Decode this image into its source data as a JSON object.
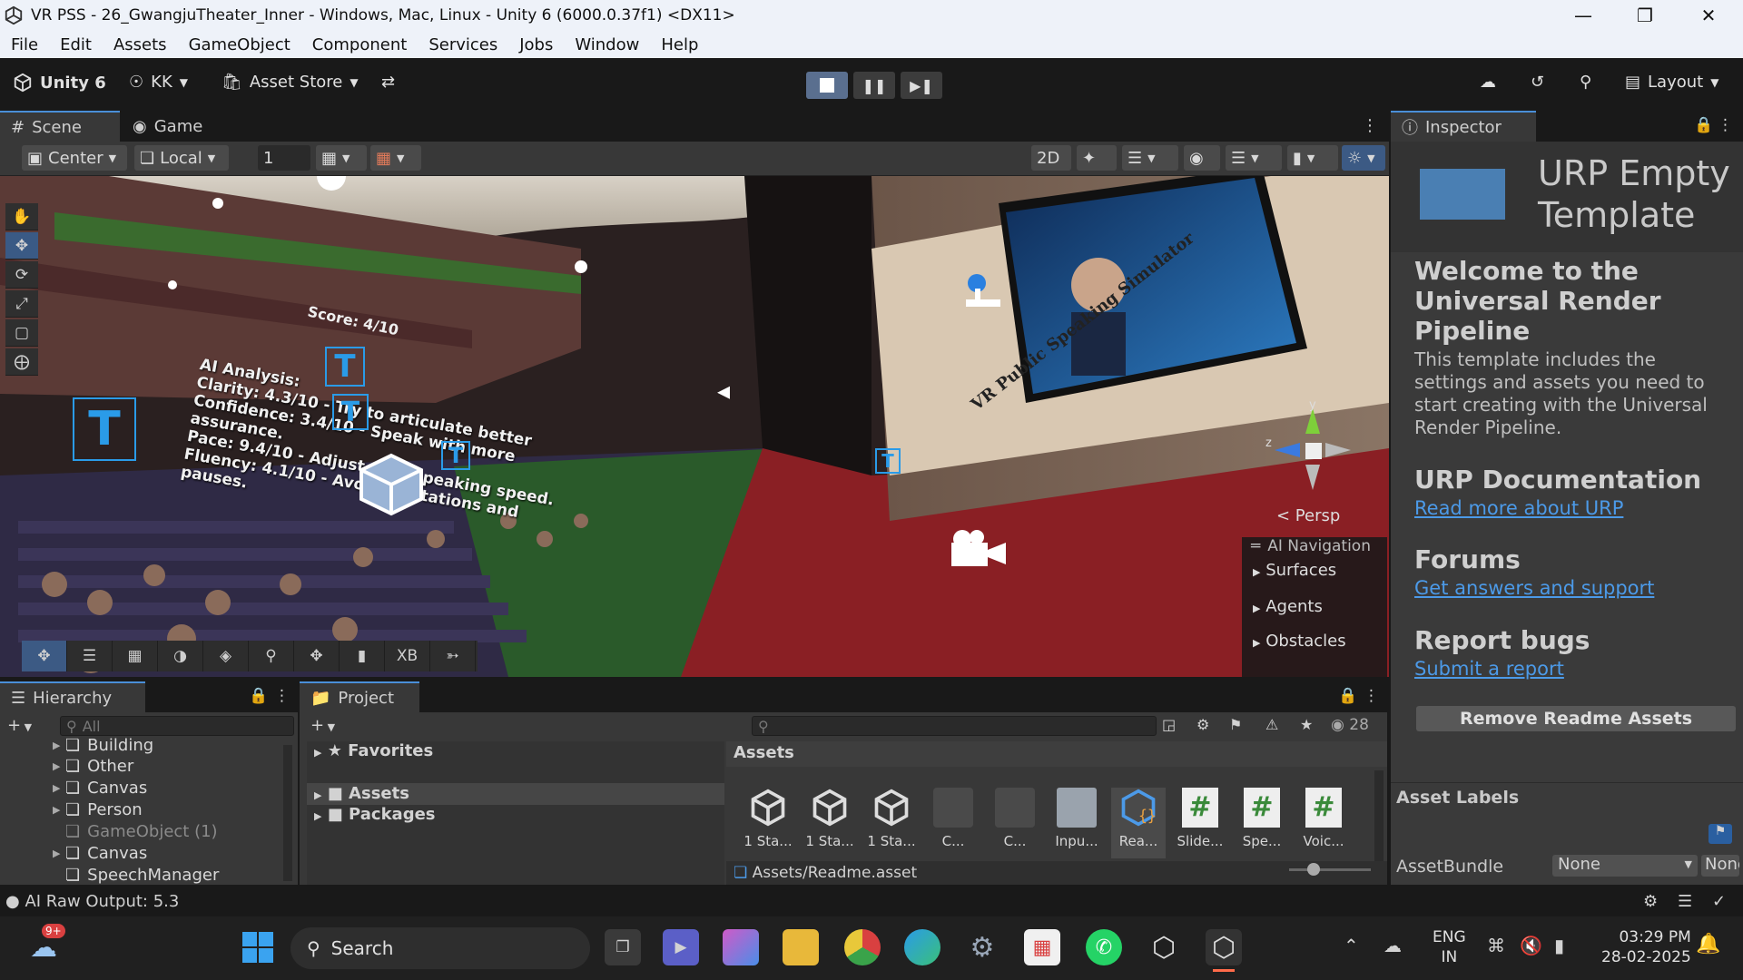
{
  "window": {
    "title": "VR PSS - 26_GwangjuTheater_Inner - Windows, Mac, Linux - Unity 6 (6000.0.37f1) <DX11>"
  },
  "menu": [
    "File",
    "Edit",
    "Assets",
    "GameObject",
    "Component",
    "Services",
    "Jobs",
    "Window",
    "Help"
  ],
  "toolbar": {
    "unity_label": "Unity 6",
    "account": "KK",
    "asset_store": "Asset Store",
    "layout": "Layout"
  },
  "scene_tabs": {
    "scene": "Scene",
    "game": "Game"
  },
  "scene_tools": {
    "pivot": "Center",
    "space": "Local",
    "grid_value": "1"
  },
  "viewport": {
    "persp_label": "< Persp",
    "ai_nav": {
      "title": "AI Navigation",
      "items": [
        "Surfaces",
        "Agents",
        "Obstacles"
      ]
    },
    "screen_text": {
      "analysis_title": "AI Analysis:",
      "lines": [
        "Clarity: 4.3/10 - Try to articulate better",
        "Confidence: 3.4/10 - Speak with more",
        "assurance.",
        "Pace: 9.4/10 - Adjust your speaking speed.",
        "Fluency: 4.1/10 - Avoid hesitations and",
        "pauses."
      ],
      "score": "Score: 4/10",
      "poster_title": "VR Public Speaking Simulator"
    },
    "overlay_xb": "XB"
  },
  "hierarchy": {
    "tab": "Hierarchy",
    "search_placeholder": "All",
    "items": [
      {
        "label": "Building",
        "expandable": true,
        "dim": false
      },
      {
        "label": "Other",
        "expandable": true,
        "dim": false
      },
      {
        "label": "Canvas",
        "expandable": true,
        "dim": false
      },
      {
        "label": "Person",
        "expandable": true,
        "dim": false
      },
      {
        "label": "GameObject (1)",
        "expandable": false,
        "dim": true
      },
      {
        "label": "Canvas",
        "expandable": true,
        "dim": false
      },
      {
        "label": "SpeechManager",
        "expandable": false,
        "dim": false
      }
    ]
  },
  "project": {
    "tab": "Project",
    "favorites": "Favorites",
    "folders": [
      "Assets",
      "Packages"
    ],
    "breadcrumb": "Assets",
    "count": "28",
    "selected_path": "Assets/Readme.asset",
    "assets": [
      {
        "label": "1 Sta...",
        "kind": "unity"
      },
      {
        "label": "1 Sta...",
        "kind": "unity"
      },
      {
        "label": "1 Sta...",
        "kind": "unity"
      },
      {
        "label": "C...",
        "kind": "prefab"
      },
      {
        "label": "C...",
        "kind": "prefab"
      },
      {
        "label": "Inpu...",
        "kind": "input"
      },
      {
        "label": "Rea...",
        "kind": "readme"
      },
      {
        "label": "Slide...",
        "kind": "script"
      },
      {
        "label": "Spe...",
        "kind": "script"
      },
      {
        "label": "Voic...",
        "kind": "script"
      }
    ]
  },
  "inspector": {
    "tab": "Inspector",
    "header_title": "URP Empty Template",
    "welcome_title": "Welcome to the Universal Render Pipeline",
    "welcome_body": "This template includes the settings and assets you need to start creating with the Universal Render Pipeline.",
    "doc_title": "URP Documentation",
    "doc_link": "Read more about URP",
    "forums_title": "Forums",
    "forums_link": "Get answers and support",
    "bugs_title": "Report bugs",
    "bugs_link": "Submit a report",
    "remove_button": "Remove Readme Assets",
    "asset_labels": "Asset Labels",
    "asset_bundle": "AssetBundle",
    "bundle_value": "None",
    "variant_value": "None"
  },
  "status": {
    "text": "AI Raw Output: 5.3"
  },
  "taskbar": {
    "search": "Search",
    "lang1": "ENG",
    "lang2": "IN",
    "time": "03:29 PM",
    "date": "28-02-2025",
    "weather_badge": "9+"
  }
}
